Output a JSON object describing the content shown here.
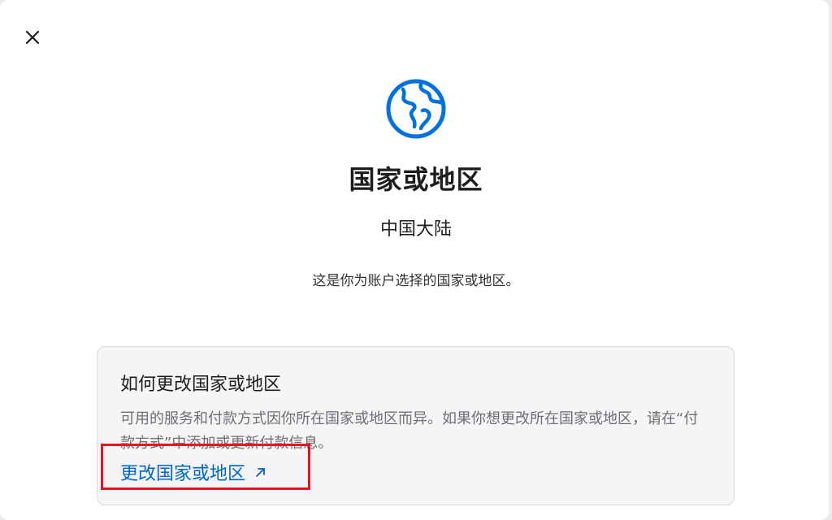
{
  "dialog": {
    "close_icon": "close-icon",
    "globe_icon": "globe-icon",
    "title": "国家或地区",
    "region_value": "中国大陆",
    "description": "这是你为账户选择的国家或地区。"
  },
  "card": {
    "title": "如何更改国家或地区",
    "body": "可用的服务和付款方式因你所在国家或地区而异。如果你想更改所在国家或地区，请在“付款方式”中添加或更新付款信息。",
    "link_label": "更改国家或地区",
    "link_icon": "external-arrow-icon"
  },
  "colors": {
    "accent": "#0071e3",
    "link": "#0066cc",
    "highlight": "#e8131f"
  }
}
